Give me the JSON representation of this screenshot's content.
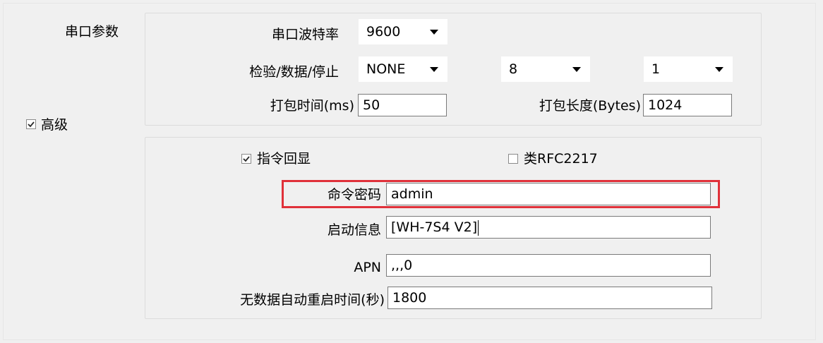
{
  "serial": {
    "section_label": "串口参数",
    "baud": {
      "label": "串口波特率",
      "value": "9600"
    },
    "check": {
      "label": "检验/数据/停止",
      "parity": "NONE",
      "data_bits": "8",
      "stop_bits": "1"
    },
    "pack_time": {
      "label": "打包时间(ms)",
      "value": "50"
    },
    "pack_len": {
      "label": "打包长度(Bytes)",
      "value": "1024"
    }
  },
  "advanced": {
    "label": "高级",
    "checked": true,
    "echo": {
      "label": "指令回显",
      "checked": true
    },
    "rfc": {
      "label": "类RFC2217",
      "checked": false
    },
    "cmd_password": {
      "label": "命令密码",
      "value": "admin"
    },
    "boot_info": {
      "label": "启动信息",
      "value": "[WH-7S4 V2]"
    },
    "apn": {
      "label": "APN",
      "value": ",,,0"
    },
    "restart": {
      "label": "无数据自动重启时间(秒)",
      "value": "1800"
    }
  },
  "colors": {
    "highlight": "#e0313a",
    "background": "#f0f0f0"
  }
}
